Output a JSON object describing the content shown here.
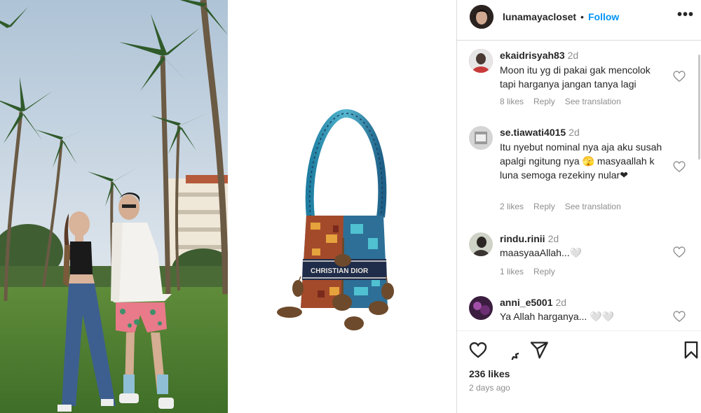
{
  "post": {
    "username": "lunamayacloset",
    "separator": "•",
    "follow_label": "Follow",
    "more_label": "•••"
  },
  "comments": [
    {
      "username": "ekaidrisyah83",
      "time": "2d",
      "text": "Moon itu yg di pakai gak mencolok tapi harganya jangan tanya lagi",
      "likes": "8 likes",
      "reply": "Reply",
      "translate": "See translation"
    },
    {
      "username": "se.tiawati4015",
      "time": "2d",
      "text": "Itu nyebut nominal nya aja aku susah apalgi ngitung nya 🫣 masyaallah k luna semoga rezekiny nular❤",
      "likes": "2 likes",
      "reply": "Reply",
      "translate": "See translation"
    },
    {
      "username": "rindu.rinii",
      "time": "2d",
      "text": "maasyaaAllah...🤍",
      "likes": "1 likes",
      "reply": "Reply"
    },
    {
      "username": "anni_e5001",
      "time": "2d",
      "text": "Ya Allah harganya... 🤍🤍"
    }
  ],
  "footer": {
    "likes": "236 likes",
    "posted": "2 days ago"
  },
  "colors": {
    "follow": "#0095f6",
    "muted": "#8e8e8e",
    "border": "#dbdbdb"
  },
  "product": {
    "brand_text": "CHRISTIAN DIOR"
  }
}
